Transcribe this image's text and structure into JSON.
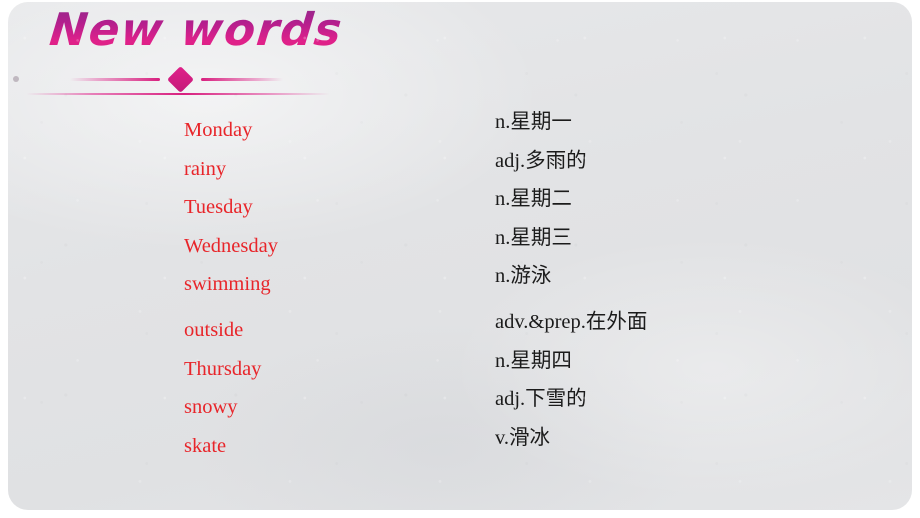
{
  "slide": {
    "title": "New words",
    "divider": {
      "diamond_icon": "diamond-ornament",
      "dot_icon": "bullet-dot"
    },
    "colors": {
      "background": "#e2e3e5",
      "title_gradient_start": "#8d2a8c",
      "title_gradient_end": "#e0218a",
      "word_red": "#e8252a",
      "meaning_black": "#1b1b1b",
      "accent_pink": "#d8207f"
    }
  },
  "vocabulary": [
    {
      "word": "Monday",
      "meaning": "n.星期一",
      "spaced_after": false
    },
    {
      "word": "rainy",
      "meaning": "adj.多雨的",
      "spaced_after": false
    },
    {
      "word": "Tuesday",
      "meaning": "n.星期二",
      "spaced_after": false
    },
    {
      "word": "Wednesday",
      "meaning": "n.星期三",
      "spaced_after": false
    },
    {
      "word": "swimming",
      "meaning": "n.游泳",
      "spaced_after": true
    },
    {
      "word": "outside",
      "meaning": "adv.&prep.在外面",
      "spaced_after": false
    },
    {
      "word": "Thursday",
      "meaning": "n.星期四",
      "spaced_after": false
    },
    {
      "word": "snowy",
      "meaning": "adj.下雪的",
      "spaced_after": false
    },
    {
      "word": "skate",
      "meaning": "v.滑冰",
      "spaced_after": false
    }
  ]
}
